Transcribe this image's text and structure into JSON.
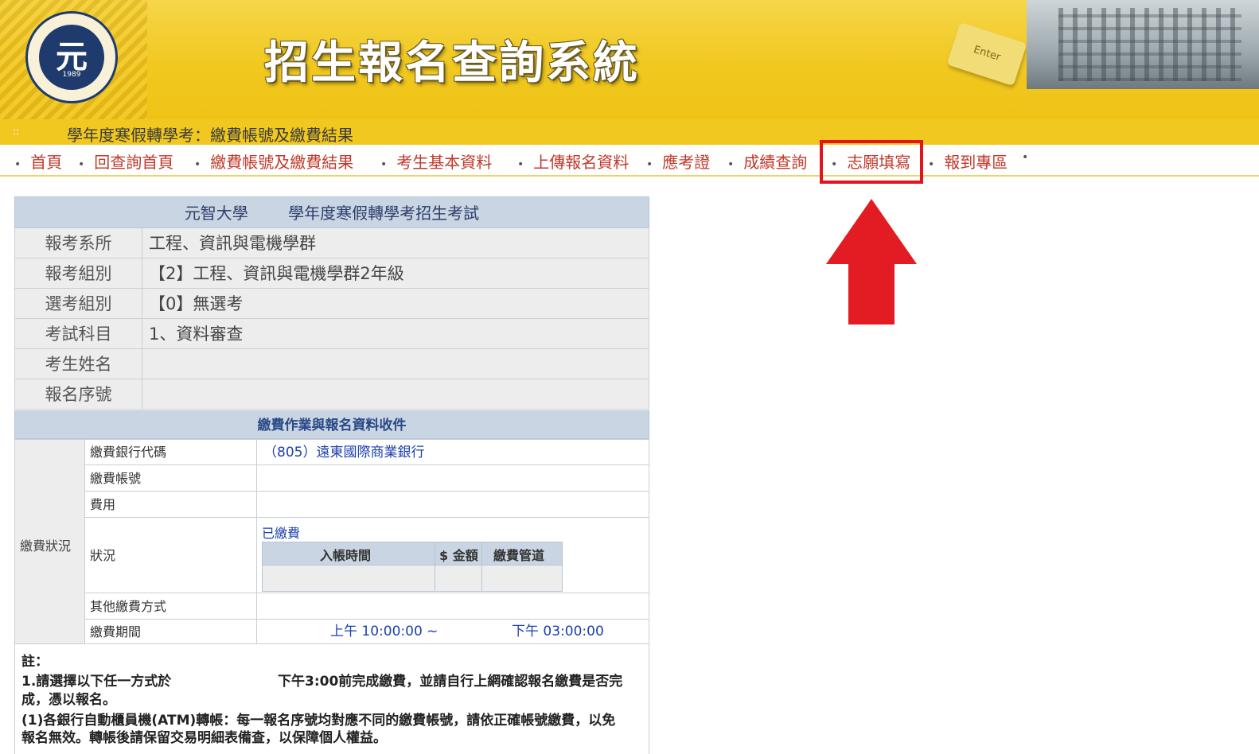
{
  "banner": {
    "title": "招生報名查詢系統",
    "logo_mark": "元",
    "logo_year": "1989",
    "enter_key": "Enter",
    "subheading": "學年度寒假轉學考：繳費帳號及繳費結果",
    "subhead_icon": "::"
  },
  "nav": {
    "items": [
      {
        "label": "首頁"
      },
      {
        "label": "回查詢首頁"
      },
      {
        "label": "繳費帳號及繳費結果"
      },
      {
        "label": "考生基本資料"
      },
      {
        "label": "上傳報名資料"
      },
      {
        "label": "應考證"
      },
      {
        "label": "成績查詢"
      },
      {
        "label": "志願填寫"
      },
      {
        "label": "報到專區"
      }
    ],
    "separator": "•",
    "highlighted": "志願填寫",
    "highlight_color": "#e3141c"
  },
  "exam": {
    "header_university": "元智大學",
    "header_exam": "學年度寒假轉學考招生考試",
    "rows": [
      {
        "label": "報考系所",
        "value": "工程、資訊與電機學群"
      },
      {
        "label": "報考組別",
        "value": "【2】工程、資訊與電機學群2年級"
      },
      {
        "label": "選考組別",
        "value": "【0】無選考"
      },
      {
        "label": "考試科目",
        "value": "1、資料審查"
      },
      {
        "label": "考生姓名",
        "value": ""
      },
      {
        "label": "報名序號",
        "value": ""
      }
    ]
  },
  "payment": {
    "section_title": "繳費作業與報名資料收件",
    "side_label": "繳費狀況",
    "bank_label": "繳費銀行代碼",
    "bank_value": "（805）遠東國際商業銀行",
    "account_label": "繳費帳號",
    "account_value": "",
    "fee_label": "費用",
    "fee_value": "",
    "status_label": "狀況",
    "status_value": "已繳費",
    "status_table": {
      "headers": [
        "入帳時間",
        "$ 金額",
        "繳費管道"
      ],
      "rows": [
        [
          "",
          "",
          ""
        ]
      ]
    },
    "other_label": "其他繳費方式",
    "other_value": "",
    "period_label": "繳費期間",
    "period_start": "上午 10:00:00 ~",
    "period_end": "下午 03:00:00"
  },
  "notes": {
    "title": "註：",
    "line1a": "1.請選擇以下任一方式於",
    "line1b": "下午3:00前完成繳費，並請自行上網確認報名繳費是否完",
    "line2": "成，憑以報名。",
    "line3": "(1)各銀行自動櫃員機(ATM)轉帳：每一報名序號均對應不同的繳費帳號，請依正確帳號繳費，以免",
    "line4": "報名無效。轉帳後請保留交易明細表備查，以保障個人權益。"
  },
  "icons": [
    "university-logo",
    "enter-key-icon",
    "red-up-arrow"
  ]
}
